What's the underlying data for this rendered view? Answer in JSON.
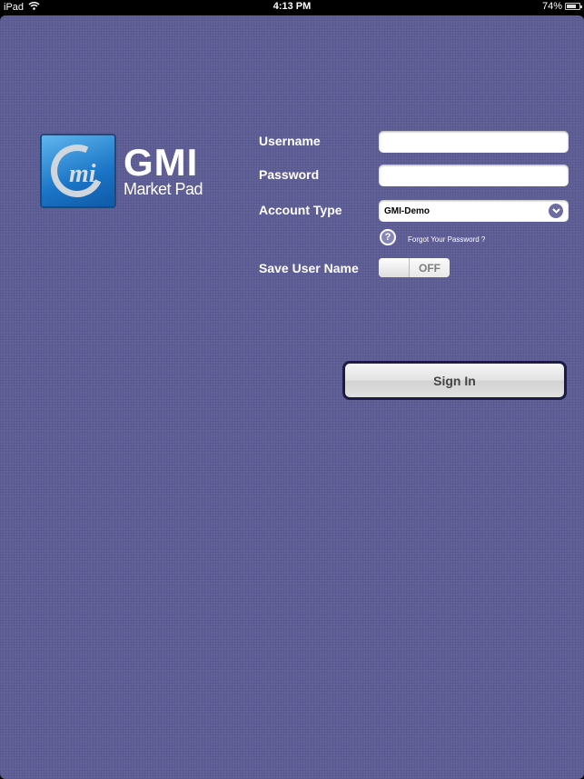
{
  "status_bar": {
    "device": "iPad",
    "time": "4:13 PM",
    "battery": "74%",
    "battery_level": 0.74
  },
  "logo": {
    "monogram": "mi",
    "title": "GMI",
    "subtitle": "Market Pad"
  },
  "form": {
    "username_label": "Username",
    "username_value": "",
    "password_label": "Password",
    "password_value": "",
    "account_type_label": "Account Type",
    "account_type_value": "GMI-Demo",
    "help_icon": "?",
    "forgot_password": "Forgot Your Password ?",
    "save_username_label": "Save User Name",
    "save_username_state": "OFF",
    "sign_in": "Sign In"
  },
  "colors": {
    "background": "#62629a",
    "accent": "#6c6ca0"
  }
}
